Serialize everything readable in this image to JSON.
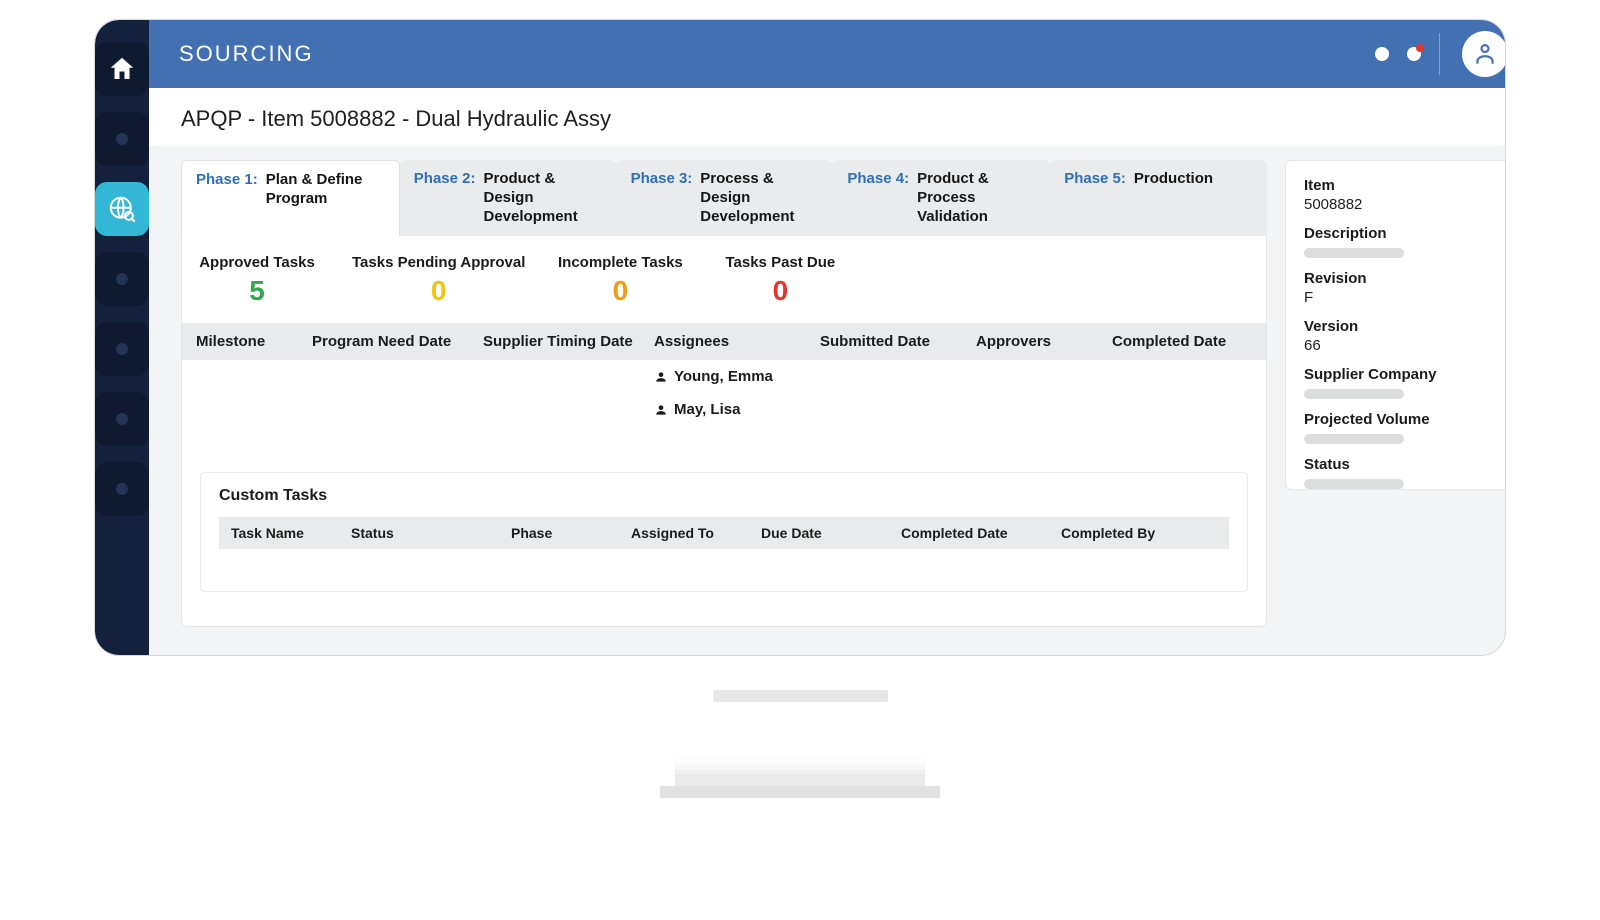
{
  "header": {
    "title": "SOURCING"
  },
  "page": {
    "title": "APQP - Item 5008882 - Dual Hydraulic Assy"
  },
  "tabs": [
    {
      "prefix": "Phase 1:",
      "label": "Plan & Define Program"
    },
    {
      "prefix": "Phase 2:",
      "label": "Product & Design Development"
    },
    {
      "prefix": "Phase 3:",
      "label": "Process & Design Development"
    },
    {
      "prefix": "Phase 4:",
      "label": "Product & Process Validation"
    },
    {
      "prefix": "Phase 5:",
      "label": "Production"
    }
  ],
  "kpis": {
    "approved": {
      "label": "Approved Tasks",
      "value": "5"
    },
    "pending": {
      "label": "Tasks Pending Approval",
      "value": "0"
    },
    "incomplete": {
      "label": "Incomplete Tasks",
      "value": "0"
    },
    "pastdue": {
      "label": "Tasks Past Due",
      "value": "0"
    }
  },
  "columns": {
    "milestone": "Milestone",
    "program_date": "Program Need Date",
    "supplier_date": "Supplier Timing Date",
    "assignees": "Assignees",
    "submitted": "Submitted Date",
    "approvers": "Approvers",
    "completed": "Completed Date"
  },
  "rows": [
    {
      "assignee": "Young, Emma"
    },
    {
      "assignee": "May, Lisa"
    },
    {
      "assignee": ""
    },
    {
      "assignee": ""
    }
  ],
  "subpanel": {
    "title": "Custom Tasks",
    "columns": {
      "task_name": "Task Name",
      "status": "Status",
      "phase": "Phase",
      "assigned_to": "Assigned To",
      "due_date": "Due Date",
      "completed_date": "Completed Date",
      "completed_by": "Completed By"
    }
  },
  "sidecard": {
    "item": {
      "label": "Item",
      "value": "5008882"
    },
    "description": {
      "label": "Description"
    },
    "revision": {
      "label": "Revision",
      "value": "F"
    },
    "version": {
      "label": "Version",
      "value": "66"
    },
    "supplier_company": {
      "label": "Supplier Company"
    },
    "projected_volume": {
      "label": "Projected Volume"
    },
    "status": {
      "label": "Status"
    }
  },
  "colors": {
    "accent_blue": "#4370b3",
    "rail_bg": "#14213d",
    "active_rail": "#32b7d6",
    "green": "#2fa84f",
    "yellow": "#f1c40f",
    "orange": "#f39c12",
    "red": "#e5352c"
  }
}
